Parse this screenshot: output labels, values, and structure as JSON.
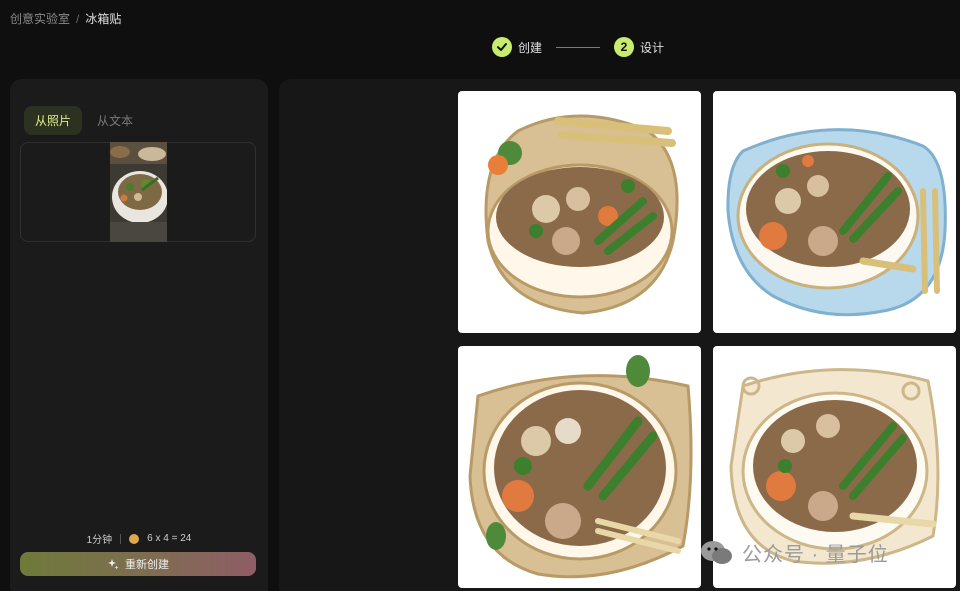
{
  "breadcrumb": {
    "parent": "创意实验室",
    "separator": "/",
    "current": "冰箱贴"
  },
  "stepper": {
    "step1": {
      "label": "创建",
      "icon": "check-icon"
    },
    "step2": {
      "number": "2",
      "label": "设计"
    }
  },
  "tabs": [
    {
      "label": "从照片",
      "active": true
    },
    {
      "label": "从文本",
      "active": false
    }
  ],
  "cost": {
    "time": "1分钟",
    "formula": "6 x 4 = 24"
  },
  "recreate_button": {
    "label": "重新创建",
    "icon": "sparkle-icon"
  },
  "results": {
    "count": 4,
    "subject": "soup-bowl-fridge-magnet"
  },
  "watermark": {
    "text": "公众号 · 量子位"
  },
  "colors": {
    "accent": "#c7ec6e",
    "panel": "#1b1b1b",
    "background": "#0f0f0f"
  }
}
